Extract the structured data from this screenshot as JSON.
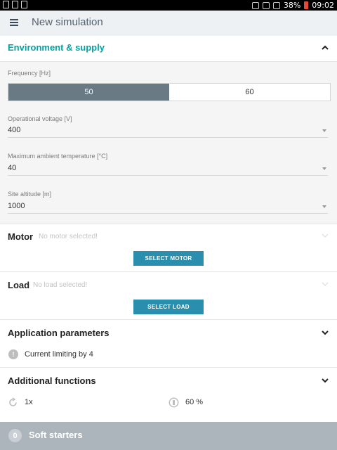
{
  "status_bar": {
    "battery": "38%",
    "time": "09:02"
  },
  "appbar": {
    "title": "New simulation"
  },
  "environment": {
    "title": "Environment & supply",
    "frequency": {
      "label": "Frequency [Hz]",
      "options": [
        "50",
        "60"
      ],
      "selected": "50"
    },
    "operational_voltage": {
      "label": "Operational voltage [V]",
      "value": "400"
    },
    "ambient_temp": {
      "label": "Maximum ambient temperature [°C]",
      "value": "40"
    },
    "altitude": {
      "label": "Site altitude [m]",
      "value": "1000"
    }
  },
  "motor": {
    "title": "Motor",
    "note": "No motor selected!",
    "button": "SELECT MOTOR"
  },
  "load": {
    "title": "Load",
    "note": "No load selected!",
    "button": "SELECT LOAD"
  },
  "application": {
    "title": "Application parameters",
    "badge": "!",
    "item": "Current limiting by 4"
  },
  "additional": {
    "title": "Additional functions",
    "item1": "1x",
    "item2": "60 %"
  },
  "bottom": {
    "count": "0",
    "title": "Soft starters"
  },
  "colors": {
    "accent": "#00a3a3",
    "button": "#2a8fae",
    "segment_selected": "#6a7a85"
  }
}
